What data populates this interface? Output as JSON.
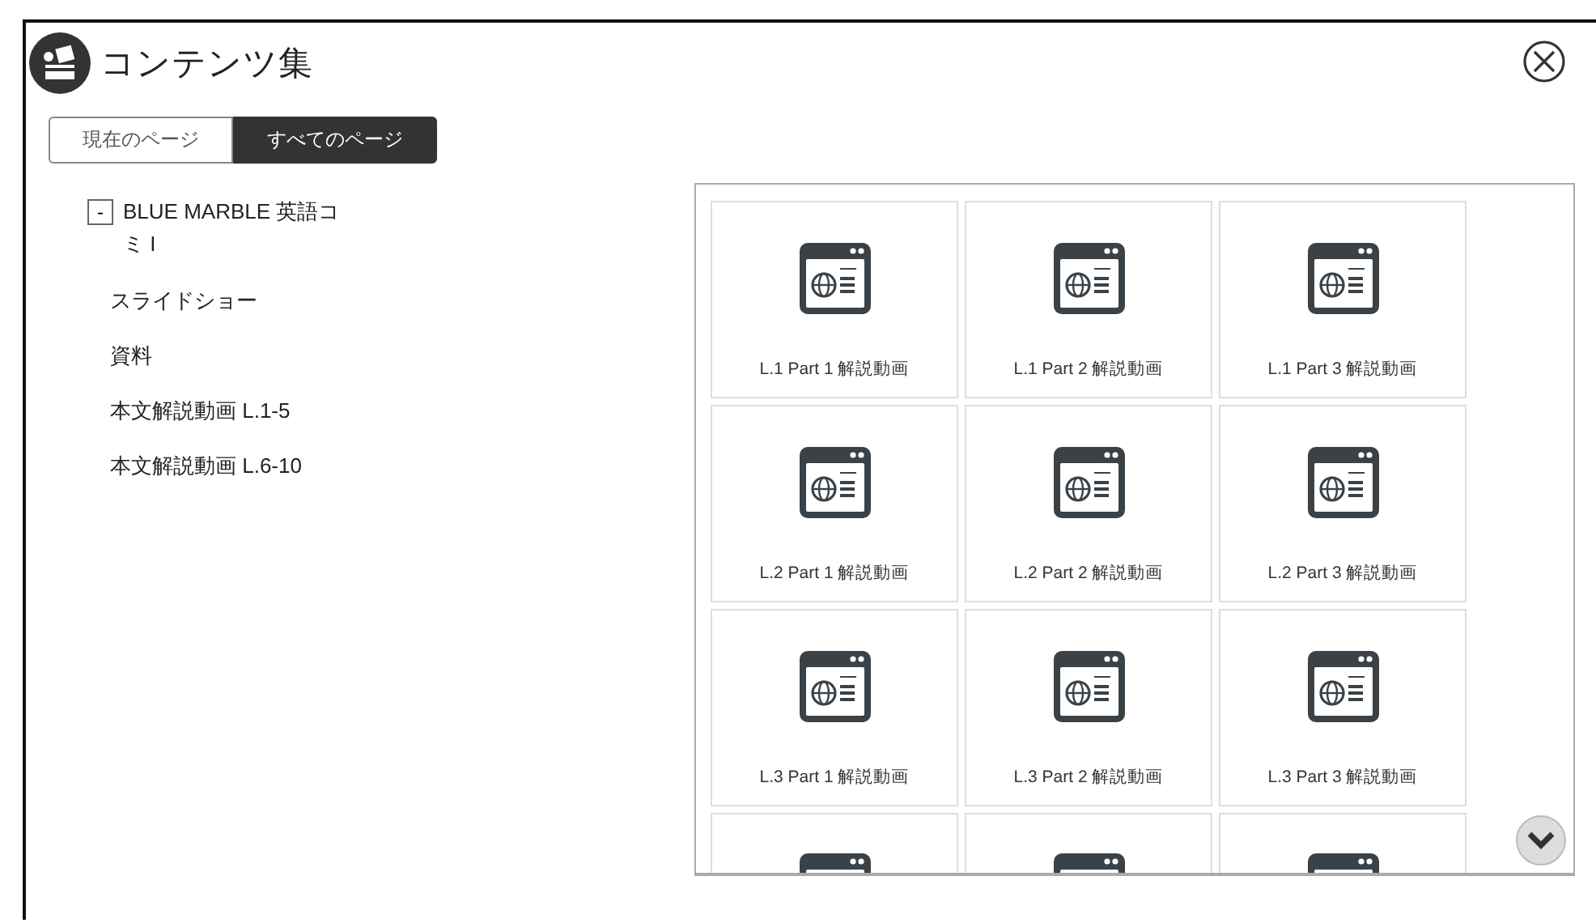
{
  "header": {
    "title": "コンテンツ集"
  },
  "tabs": [
    {
      "label": "現在のページ",
      "selected": false
    },
    {
      "label": "すべてのページ",
      "selected": true
    }
  ],
  "tree": {
    "label": "BLUE MARBLE 英語コミ I",
    "expanded": true,
    "toggle": "-",
    "children": [
      {
        "label": "スライドショー"
      },
      {
        "label": "資料"
      },
      {
        "label": "本文解説動画 L.1-5"
      },
      {
        "label": "本文解説動画 L.6-10"
      }
    ]
  },
  "tiles": [
    {
      "label": "L.1 Part 1 解説動画"
    },
    {
      "label": "L.1 Part 2 解説動画"
    },
    {
      "label": "L.1 Part 3 解説動画"
    },
    {
      "label": "L.2 Part 1 解説動画"
    },
    {
      "label": "L.2 Part 2 解説動画"
    },
    {
      "label": "L.2 Part 3 解説動画"
    },
    {
      "label": "L.3 Part 1 解説動画"
    },
    {
      "label": "L.3 Part 2 解説動画"
    },
    {
      "label": "L.3 Part 3 解説動画"
    },
    {
      "kind": "partial"
    },
    {
      "kind": "partial"
    },
    {
      "kind": "partial"
    }
  ]
}
